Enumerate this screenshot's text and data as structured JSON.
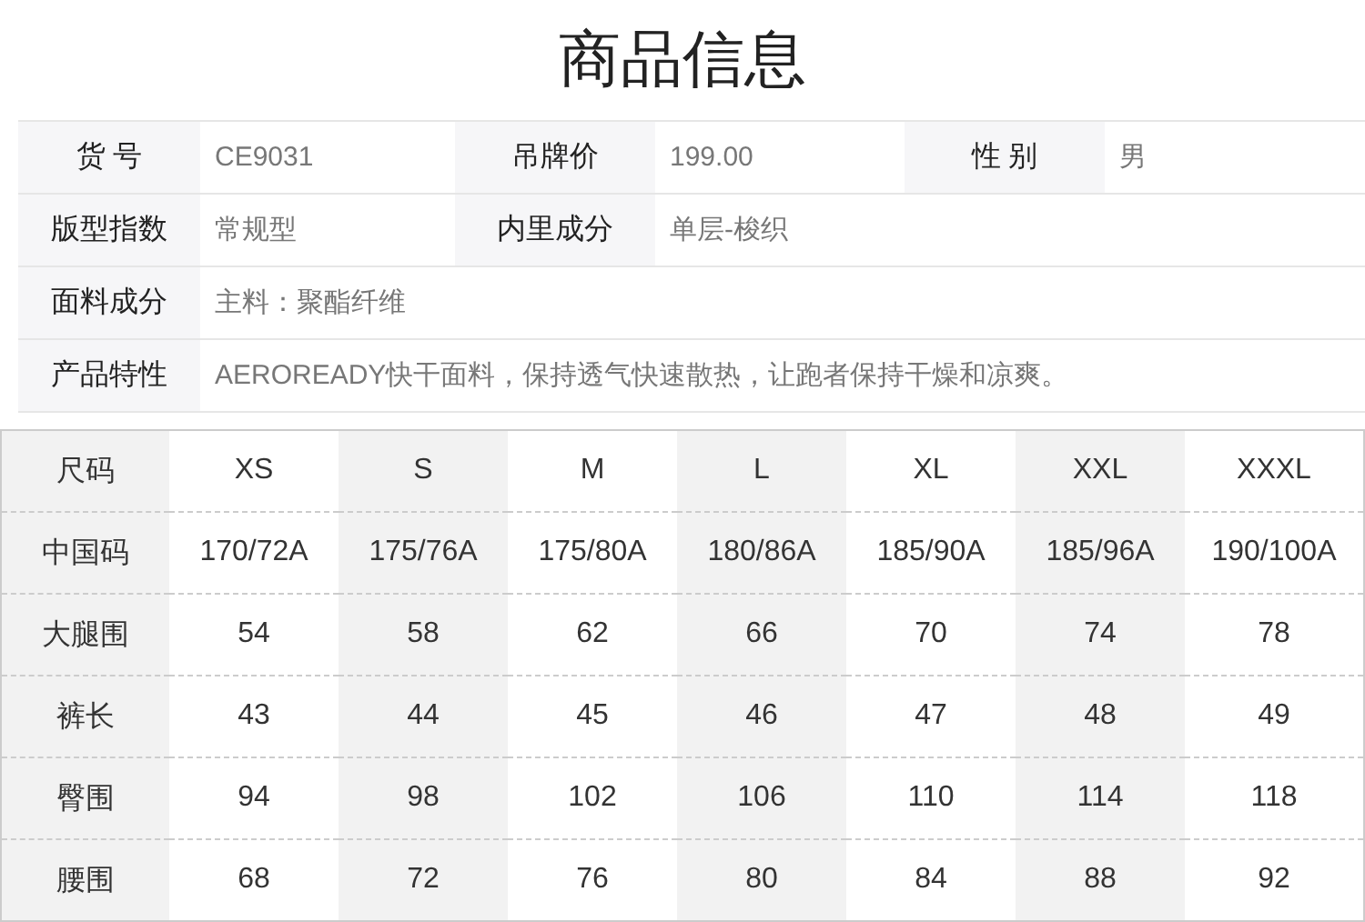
{
  "title": "商品信息",
  "info": {
    "rows": [
      {
        "fields": [
          {
            "label": "货 号",
            "value": "CE9031"
          },
          {
            "label": "吊牌价",
            "value": "199.00"
          },
          {
            "label": "性 别",
            "value": "男"
          }
        ]
      },
      {
        "fields": [
          {
            "label": "版型指数",
            "value": "常规型"
          },
          {
            "label": "内里成分",
            "value": "单层-梭织"
          }
        ]
      },
      {
        "fields": [
          {
            "label": "面料成分",
            "value": "主料：聚酯纤维"
          }
        ]
      },
      {
        "fields": [
          {
            "label": "产品特性",
            "value": "AEROREADY快干面料，保持透气快速散热，让跑者保持干燥和凉爽。"
          }
        ]
      }
    ]
  },
  "size_table": {
    "header_label": "尺码",
    "sizes": [
      "XS",
      "S",
      "M",
      "L",
      "XL",
      "XXL",
      "XXXL"
    ],
    "rows": [
      {
        "label": "中国码",
        "values": [
          "170/72A",
          "175/76A",
          "175/80A",
          "180/86A",
          "185/90A",
          "185/96A",
          "190/100A"
        ]
      },
      {
        "label": "大腿围",
        "values": [
          "54",
          "58",
          "62",
          "66",
          "70",
          "74",
          "78"
        ]
      },
      {
        "label": "裤长",
        "values": [
          "43",
          "44",
          "45",
          "46",
          "47",
          "48",
          "49"
        ]
      },
      {
        "label": "臀围",
        "values": [
          "94",
          "98",
          "102",
          "106",
          "110",
          "114",
          "118"
        ]
      },
      {
        "label": "腰围",
        "values": [
          "68",
          "72",
          "76",
          "80",
          "84",
          "88",
          "92"
        ]
      }
    ]
  }
}
